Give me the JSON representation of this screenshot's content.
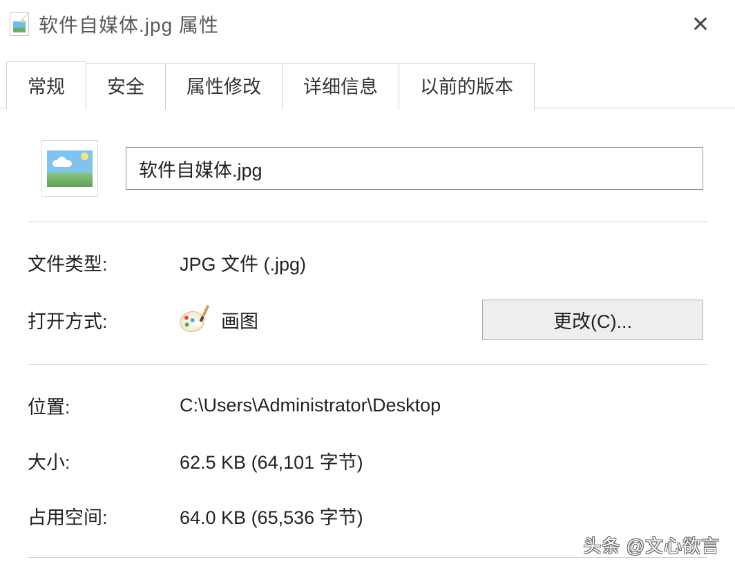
{
  "titlebar": {
    "title": "软件自媒体.jpg 属性"
  },
  "tabs": [
    {
      "label": "常规",
      "active": true
    },
    {
      "label": "安全",
      "active": false
    },
    {
      "label": "属性修改",
      "active": false
    },
    {
      "label": "详细信息",
      "active": false
    },
    {
      "label": "以前的版本",
      "active": false
    }
  ],
  "file": {
    "name": "软件自媒体.jpg"
  },
  "properties": {
    "file_type_label": "文件类型:",
    "file_type_value": "JPG 文件 (.jpg)",
    "open_with_label": "打开方式:",
    "open_with_value": "画图",
    "change_button": "更改(C)...",
    "location_label": "位置:",
    "location_value": "C:\\Users\\Administrator\\Desktop",
    "size_label": "大小:",
    "size_value": "62.5 KB (64,101 字节)",
    "size_on_disk_label": "占用空间:",
    "size_on_disk_value": "64.0 KB (65,536 字节)"
  },
  "watermark": "头条 @文心欲言"
}
